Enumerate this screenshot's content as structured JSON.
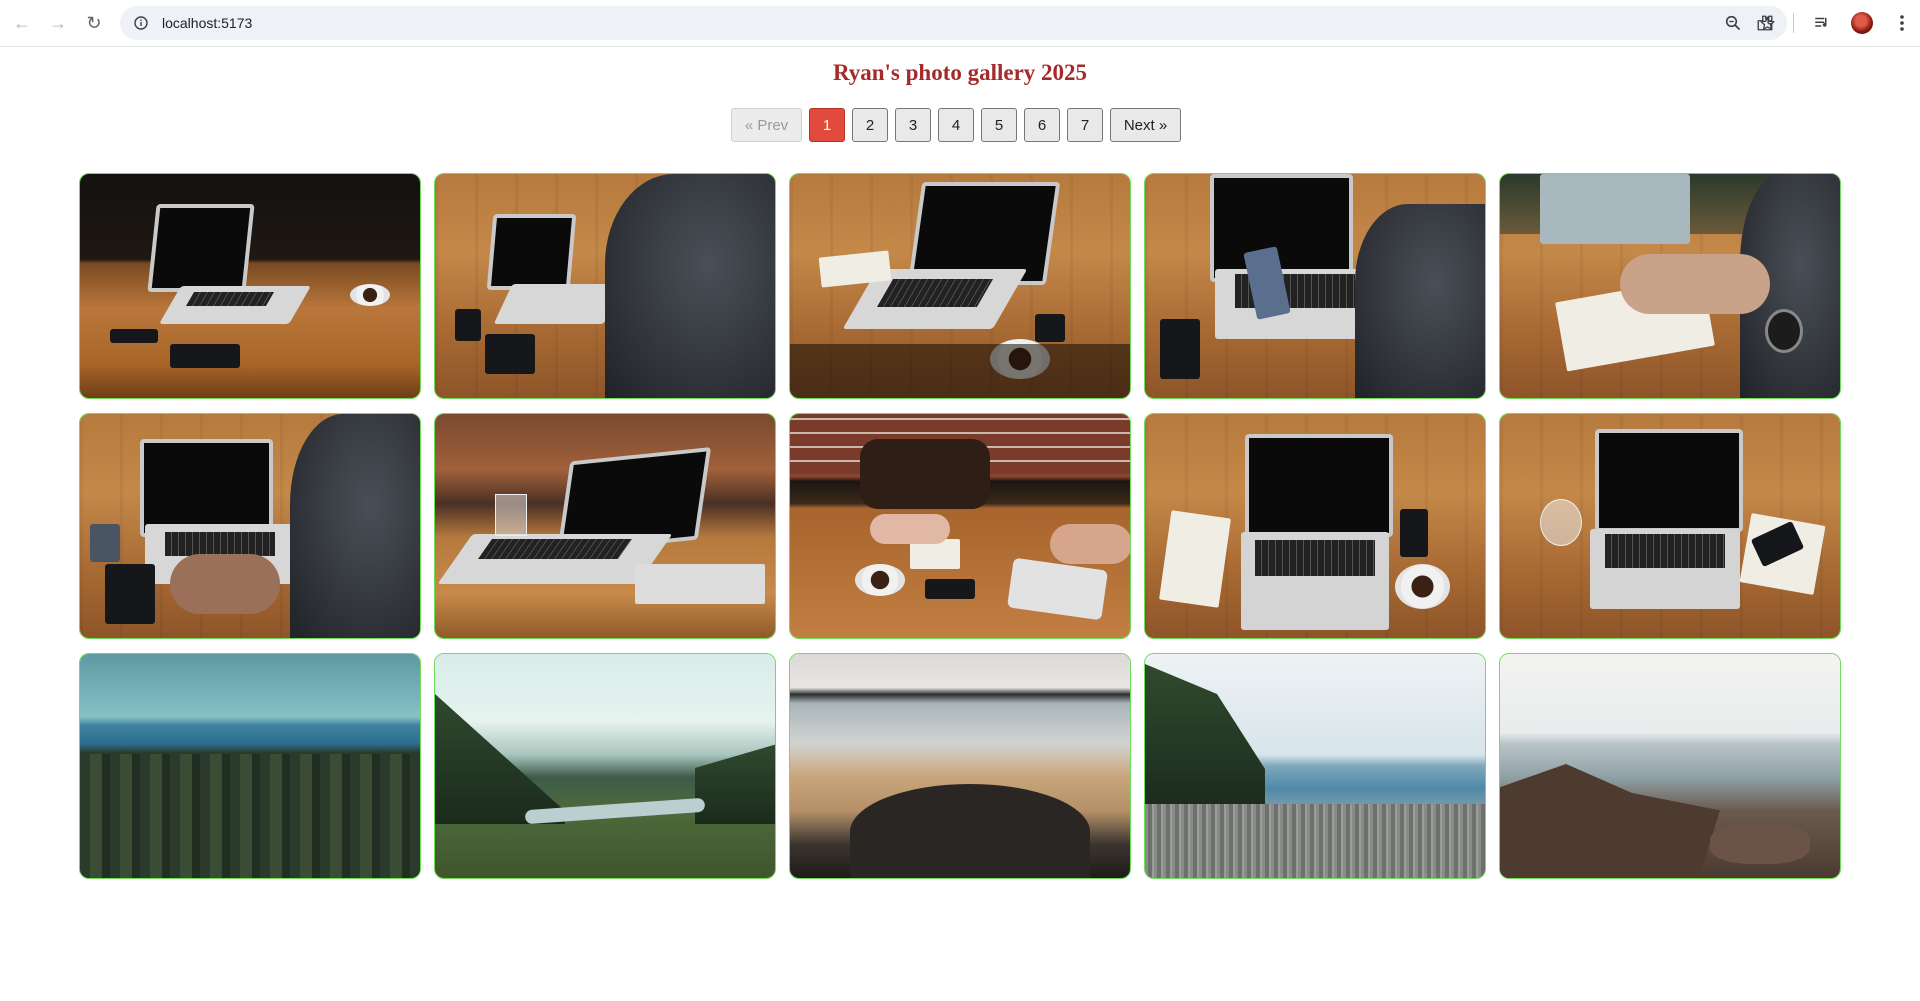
{
  "browser": {
    "url": "localhost:5173"
  },
  "page": {
    "title": "Ryan's photo gallery 2025"
  },
  "pagination": {
    "prev_label": "« Prev",
    "next_label": "Next »",
    "pages": [
      "1",
      "2",
      "3",
      "4",
      "5",
      "6",
      "7"
    ],
    "current": "1"
  },
  "colors": {
    "title": "#a52a2a",
    "active_page": "#e24b3b",
    "card_border": "#6fdc5a"
  },
  "gallery": {
    "photos": [
      {
        "scene": "laptop on wooden table with coffee cup, dark background"
      },
      {
        "scene": "person typing on laptop at wooden table"
      },
      {
        "scene": "laptop with notebook, pen and coffee on table"
      },
      {
        "scene": "person holding phone over laptop"
      },
      {
        "scene": "hands writing in notebook next to laptop"
      },
      {
        "scene": "person typing on laptop with phone and notebook"
      },
      {
        "scene": "laptop on wooden table with glass of water"
      },
      {
        "scene": "two people at table with bag, tablet and coffee"
      },
      {
        "scene": "top-down laptop with notebook, phone and coffee"
      },
      {
        "scene": "top-down laptop with glass and phone on notebook"
      },
      {
        "scene": "forest overlooking sea and mountains"
      },
      {
        "scene": "misty valley with river and forest"
      },
      {
        "scene": "rocky beach with islands in distance"
      },
      {
        "scene": "pebble shore with trees and calm sea"
      },
      {
        "scene": "rocky coastline with calm sea"
      }
    ]
  }
}
